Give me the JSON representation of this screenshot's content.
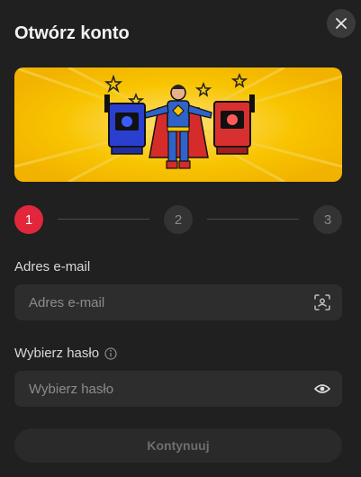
{
  "modal": {
    "title": "Otwórz konto",
    "close_icon": "close-icon"
  },
  "banner": {
    "image": "superhero-slot-machines-illustration",
    "colors": {
      "background": "#f6c500",
      "hero_suit": "#2f63c9",
      "cape": "#d62b2b"
    }
  },
  "steps": [
    {
      "number": "1",
      "state": "active"
    },
    {
      "number": "2",
      "state": "inactive"
    },
    {
      "number": "3",
      "state": "inactive"
    }
  ],
  "form": {
    "email": {
      "label": "Adres e-mail",
      "placeholder": "Adres e-mail",
      "value": "",
      "icon": "scan-face-icon"
    },
    "password": {
      "label": "Wybierz hasło",
      "info_icon": "info-icon",
      "placeholder": "Wybierz hasło",
      "value": "",
      "icon": "eye-icon"
    },
    "submit_label": "Kontynuuj"
  },
  "colors": {
    "background": "#202020",
    "accent": "#e2263b",
    "field": "#2d2d2d"
  }
}
